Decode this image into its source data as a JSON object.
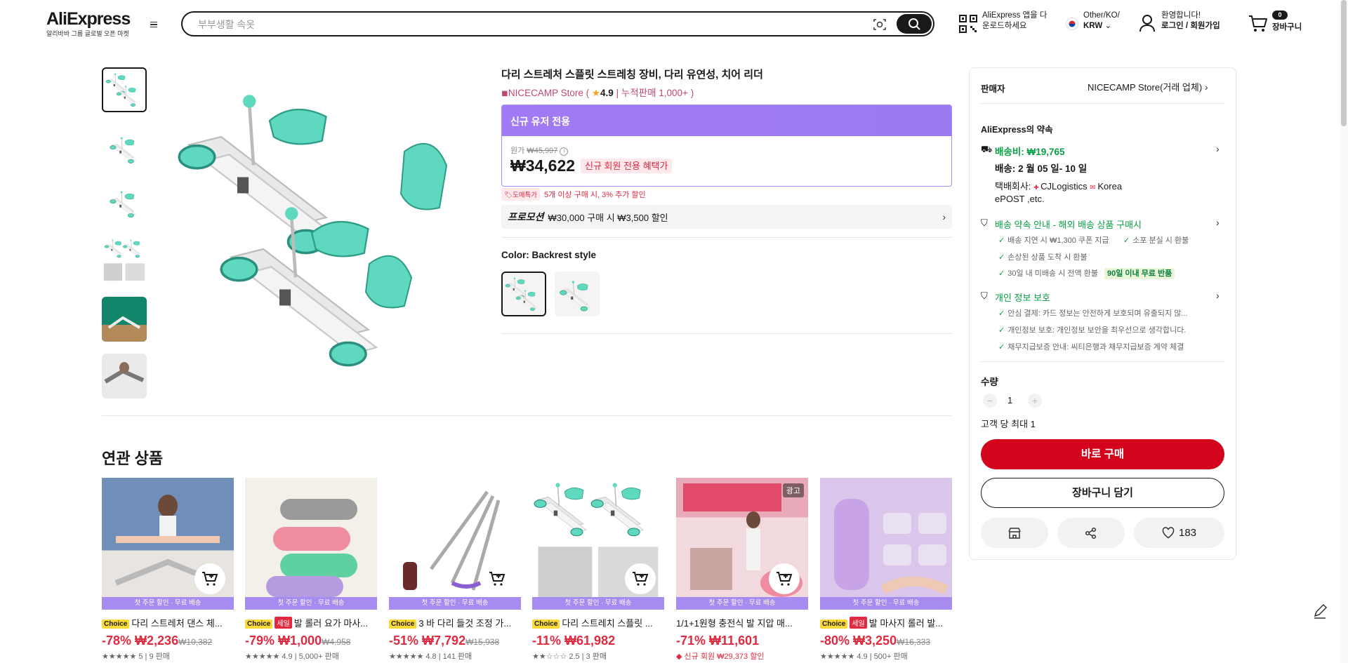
{
  "header": {
    "logo": "AliExpress",
    "logo_sub": "알리바바 그룹 글로벌 오픈 마켓",
    "search_placeholder": "부부생활 속옷",
    "app_promo_line1": "AliExpress 앱을 다",
    "app_promo_line2": "운로드하세요",
    "region_line1": "Other/KO/",
    "region_line2": "KRW",
    "greeting": "환영합니다!",
    "login": "로그인 / 회원가입",
    "cart_count": "0",
    "cart_label": "장바구니"
  },
  "product": {
    "title": "다리 스트레처 스플릿 스트레칭 장비, 다리 유연성, 치어 리더",
    "store": "NICECAMP Store",
    "rating": "4.9",
    "sold": "누적판매 1,000+",
    "promo_header": "신규 유저 전용",
    "original_label": "원가",
    "original_price": "₩45,997",
    "price": "₩34,622",
    "price_tag": "신규 회원 전용 혜택가",
    "bulk_badge": "도매특가",
    "bulk_text": "5개 이상 구매 시, 3% 추가 할인",
    "promotion_label": "프로모션",
    "promotion_text": "₩30,000 구매 시 ₩3,500 할인",
    "color_label": "Color: Backrest style"
  },
  "panel": {
    "seller_label": "판매자",
    "seller_name": "NICECAMP Store(거래 업체)",
    "promise_title": "AliExpress의 약속",
    "shipping_fee": "배송비: ₩19,765",
    "delivery": "배송: 2 월 05 일- 10 일",
    "carrier_label": "택배회사:",
    "carrier_1": "CJLogistics",
    "carrier_2": "Korea",
    "carrier_3": "ePOST ,etc.",
    "guarantee_title": "배송 약속 안내 - 해외 배송 상품 구매시",
    "guarantee_items": [
      "배송 지연 시 ₩1,300 쿠폰 지급",
      "소포 분실 시 환불",
      "손상된 상품 도착 시 환불",
      "30일 내 미배송 시 전액 환불"
    ],
    "free_return": "90일 이내 무료 반품",
    "privacy_title": "개인 정보 보호",
    "privacy_items": [
      "안심 결제: 카드 정보는 안전하게 보호되며 유출되지 않...",
      "개인정보 보호: 개인정보 보안을 최우선으로 생각합니다.",
      "채무지급보증 안내: 씨티은행과 채무지급보증 계약 체결"
    ],
    "qty_label": "수량",
    "qty_value": "1",
    "qty_limit": "고객 당 최대 1",
    "buy_now": "바로 구매",
    "add_cart": "장바구니 담기",
    "wish_count": "183"
  },
  "related": {
    "title": "연관 상품",
    "banner": "첫 주문 할인 · 무료 배송",
    "ad_label": "광고",
    "items": [
      {
        "choice": "Choice",
        "sale": "",
        "title": "다리 스트레처 댄스 체...",
        "discount": "-78%",
        "price": "₩2,236",
        "orig": "₩10,382",
        "meta": "5 | 9 판매"
      },
      {
        "choice": "Choice",
        "sale": "세일",
        "title": "발 롤러 요가 마사...",
        "discount": "-79%",
        "price": "₩1,000",
        "orig": "₩4,958",
        "meta": "4.9 | 5,000+ 판매"
      },
      {
        "choice": "Choice",
        "sale": "",
        "title": "3 바 다리 들것 조정 가...",
        "discount": "-51%",
        "price": "₩7,792",
        "orig": "₩15,938",
        "meta": "4.8 | 141 판매"
      },
      {
        "choice": "Choice",
        "sale": "",
        "title": "다리 스트레치 스플릿 ...",
        "discount": "-11%",
        "price": "₩61,982",
        "orig": "",
        "meta": "2.5 | 3 판매"
      },
      {
        "choice": "",
        "sale": "",
        "title": "1/1+1원형 충전식 발 지압 매...",
        "discount": "-71%",
        "price": "₩11,601",
        "orig": "",
        "meta": "신규 회원 ₩29,373 할인"
      },
      {
        "choice": "Choice",
        "sale": "세일",
        "title": "발 마사지 롤러 발...",
        "discount": "-80%",
        "price": "₩3,250",
        "orig": "₩16,333",
        "meta": "4.9 | 500+ 판매"
      }
    ]
  },
  "colors": {
    "accent": "#e02a40",
    "buy": "#d3031c",
    "promo": "#9f7aea",
    "green": "#08a045",
    "mint": "#5fd8c0"
  }
}
